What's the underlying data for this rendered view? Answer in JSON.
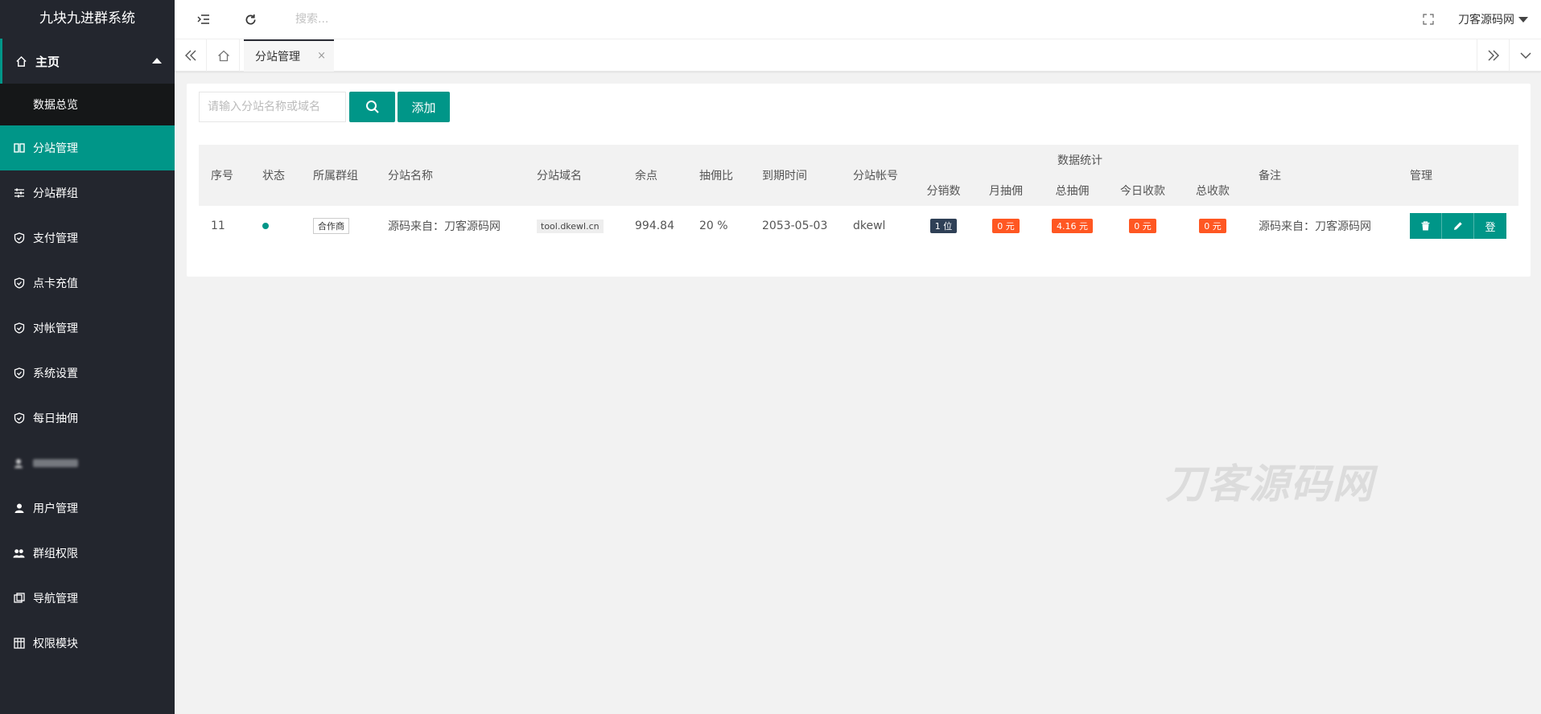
{
  "app": {
    "title": "九块九进群系统"
  },
  "sidebar": {
    "home": {
      "label": "主页",
      "icon": "home-icon"
    },
    "home_children": [
      {
        "label": "数据总览"
      }
    ],
    "items": [
      {
        "label": "分站管理",
        "icon": "columns-icon",
        "active": true
      },
      {
        "label": "分站群组",
        "icon": "sliders-icon"
      },
      {
        "label": "支付管理",
        "icon": "shield-check-icon"
      },
      {
        "label": "点卡充值",
        "icon": "shield-check-icon"
      },
      {
        "label": "对帐管理",
        "icon": "shield-check-icon"
      },
      {
        "label": "系统设置",
        "icon": "shield-check-icon"
      },
      {
        "label": "每日抽佣",
        "icon": "shield-check-icon"
      },
      {
        "label": "",
        "icon": "user-search-icon",
        "blurred": true
      },
      {
        "label": "用户管理",
        "icon": "user-icon"
      },
      {
        "label": "群组权限",
        "icon": "users-icon"
      },
      {
        "label": "导航管理",
        "icon": "nav-icon"
      },
      {
        "label": "权限模块",
        "icon": "grid-icon"
      }
    ]
  },
  "header": {
    "search_placeholder": "搜索...",
    "user_name": "刀客源码网"
  },
  "tabs": {
    "active_label": "分站管理",
    "close_glyph": "×"
  },
  "toolbar": {
    "search_placeholder": "请输入分站名称或域名",
    "add_label": "添加"
  },
  "table": {
    "headers": {
      "id": "序号",
      "status": "状态",
      "group": "所属群组",
      "name": "分站名称",
      "domain": "分站域名",
      "balance": "余点",
      "ratio": "抽佣比",
      "expire": "到期时间",
      "account": "分站帐号",
      "stats": "数据统计",
      "stats_sub": [
        "分销数",
        "月抽佣",
        "总抽佣",
        "今日收款",
        "总收款"
      ],
      "remark": "备注",
      "manage": "管理"
    },
    "rows": [
      {
        "id": "11",
        "status": "active",
        "group": "合作商",
        "name": "源码来自：刀客源码网",
        "domain": "tool.dkewl.cn",
        "balance": "994.84",
        "ratio": "20 %",
        "expire": "2053-05-03",
        "account": "dkewl",
        "distribution": "1 位",
        "month_commission": "0 元",
        "total_commission": "4.16 元",
        "today_income": "0 元",
        "total_income": "0 元",
        "remark": "源码来自：刀客源码网",
        "login_label": "登"
      }
    ]
  },
  "watermark": "刀客源码网",
  "colors": {
    "primary": "#009688",
    "sidebar": "#23262e",
    "badge_dark": "#2f4056",
    "badge_orange": "#ff5722"
  }
}
